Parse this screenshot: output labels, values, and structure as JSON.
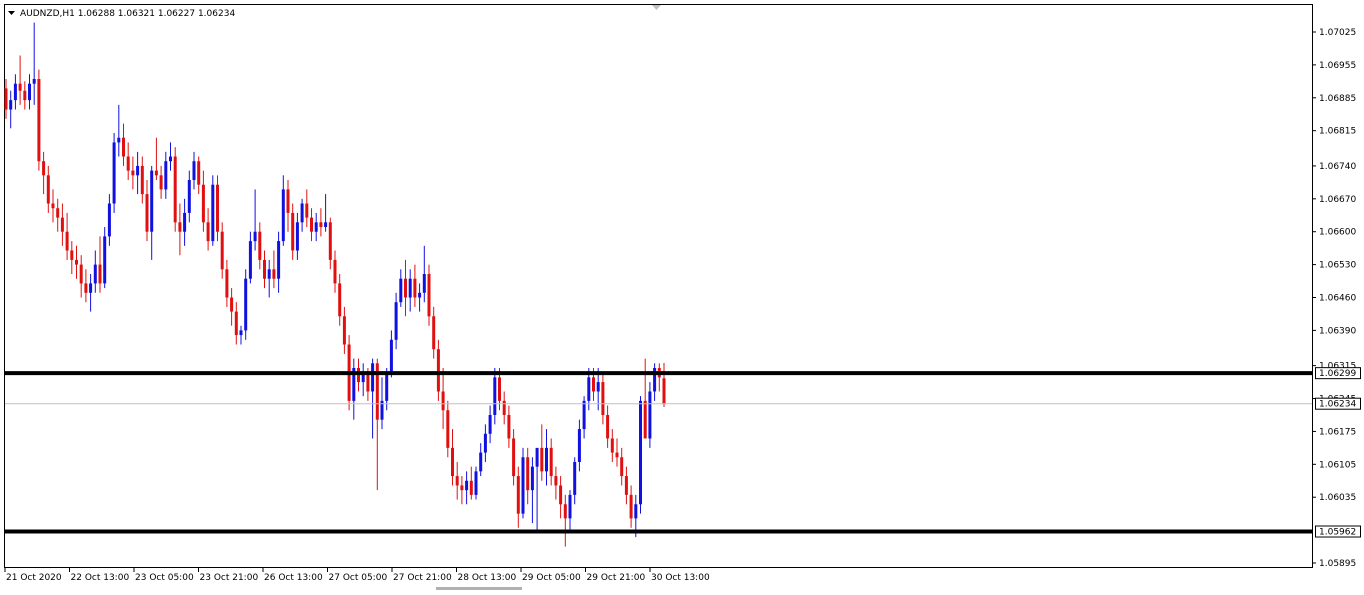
{
  "header": {
    "symbol_line": "AUDNZD,H1  1.06288 1.06321 1.06227 1.06234"
  },
  "colors": {
    "bull": "#1010e0",
    "bear": "#e01010",
    "level_line": "#000000",
    "current_line": "#c0c0c0",
    "price_tag_bg": "#000000",
    "current_tag_bg": "#000000",
    "background": "#ffffff"
  },
  "chart_data": {
    "type": "candlestick",
    "symbol": "AUDNZD",
    "timeframe": "H1",
    "header_values": {
      "open": 1.06288,
      "high": 1.06321,
      "low": 1.06227,
      "close": 1.06234
    },
    "y_ticks": [
      "1.07025",
      "1.06955",
      "1.06885",
      "1.06815",
      "1.06740",
      "1.06670",
      "1.06600",
      "1.06530",
      "1.06460",
      "1.06390",
      "1.06315",
      "1.06245",
      "1.06175",
      "1.06105",
      "1.06035",
      "1.05895"
    ],
    "x_labels": [
      "21 Oct 2020",
      "22 Oct 13:00",
      "23 Oct 05:00",
      "23 Oct 21:00",
      "26 Oct 13:00",
      "27 Oct 05:00",
      "27 Oct 21:00",
      "28 Oct 13:00",
      "29 Oct 05:00",
      "29 Oct 21:00",
      "30 Oct 13:00"
    ],
    "horizontal_levels": [
      {
        "price": 1.06299,
        "label": "1.06299"
      },
      {
        "price": 1.05962,
        "label": "1.05962"
      }
    ],
    "current_price": {
      "price": 1.06234,
      "label": "1.06234"
    },
    "candles": [
      [
        1.06905,
        1.06925,
        1.0684,
        1.0686
      ],
      [
        1.0686,
        1.069,
        1.0682,
        1.0688
      ],
      [
        1.0688,
        1.06935,
        1.0686,
        1.06915
      ],
      [
        1.06915,
        1.06975,
        1.0687,
        1.069
      ],
      [
        1.069,
        1.0692,
        1.0686,
        1.0688
      ],
      [
        1.0688,
        1.06935,
        1.0686,
        1.06915
      ],
      [
        1.06915,
        1.07045,
        1.0687,
        1.06925
      ],
      [
        1.06925,
        1.06945,
        1.0673,
        1.0675
      ],
      [
        1.0675,
        1.0677,
        1.0668,
        1.0672
      ],
      [
        1.0672,
        1.0674,
        1.0664,
        1.0666
      ],
      [
        1.0666,
        1.0669,
        1.0662,
        1.0665
      ],
      [
        1.0665,
        1.0667,
        1.066,
        1.0663
      ],
      [
        1.0663,
        1.0666,
        1.0657,
        1.066
      ],
      [
        1.066,
        1.0664,
        1.0654,
        1.0656
      ],
      [
        1.0656,
        1.0658,
        1.0651,
        1.0654
      ],
      [
        1.0654,
        1.0657,
        1.065,
        1.0653
      ],
      [
        1.0653,
        1.0655,
        1.0646,
        1.0649
      ],
      [
        1.0649,
        1.0652,
        1.0645,
        1.0647
      ],
      [
        1.0647,
        1.0651,
        1.0643,
        1.0649
      ],
      [
        1.0649,
        1.0656,
        1.0647,
        1.0653
      ],
      [
        1.0653,
        1.0659,
        1.0647,
        1.0649
      ],
      [
        1.0649,
        1.0661,
        1.0648,
        1.0659
      ],
      [
        1.0659,
        1.0668,
        1.0657,
        1.0666
      ],
      [
        1.0666,
        1.0681,
        1.0664,
        1.0679
      ],
      [
        1.0679,
        1.0687,
        1.0676,
        1.068
      ],
      [
        1.068,
        1.0683,
        1.0674,
        1.0676
      ],
      [
        1.0676,
        1.0679,
        1.0671,
        1.0673
      ],
      [
        1.0673,
        1.0676,
        1.0669,
        1.0672
      ],
      [
        1.0672,
        1.0677,
        1.0668,
        1.0674
      ],
      [
        1.0674,
        1.0676,
        1.0666,
        1.0668
      ],
      [
        1.0668,
        1.0671,
        1.0658,
        1.066
      ],
      [
        1.066,
        1.0674,
        1.0654,
        1.0673
      ],
      [
        1.0673,
        1.068,
        1.0671,
        1.0672
      ],
      [
        1.0672,
        1.0674,
        1.0667,
        1.0669
      ],
      [
        1.0669,
        1.0677,
        1.0667,
        1.0675
      ],
      [
        1.0675,
        1.0679,
        1.0673,
        1.0676
      ],
      [
        1.0676,
        1.0678,
        1.066,
        1.0662
      ],
      [
        1.0662,
        1.0666,
        1.0655,
        1.066
      ],
      [
        1.066,
        1.0667,
        1.0657,
        1.0664
      ],
      [
        1.0664,
        1.0673,
        1.0662,
        1.0671
      ],
      [
        1.0671,
        1.0677,
        1.0669,
        1.0675
      ],
      [
        1.0675,
        1.0676,
        1.0668,
        1.067
      ],
      [
        1.067,
        1.0673,
        1.066,
        1.0662
      ],
      [
        1.0662,
        1.0665,
        1.0656,
        1.0658
      ],
      [
        1.0658,
        1.0672,
        1.0657,
        1.067
      ],
      [
        1.067,
        1.0672,
        1.0658,
        1.066
      ],
      [
        1.066,
        1.0662,
        1.065,
        1.0652
      ],
      [
        1.0652,
        1.0654,
        1.0644,
        1.0646
      ],
      [
        1.0646,
        1.0648,
        1.064,
        1.0643
      ],
      [
        1.0643,
        1.0645,
        1.0636,
        1.0638
      ],
      [
        1.0638,
        1.064,
        1.0636,
        1.0639
      ],
      [
        1.0639,
        1.0652,
        1.0637,
        1.065
      ],
      [
        1.065,
        1.066,
        1.0649,
        1.0658
      ],
      [
        1.0658,
        1.0669,
        1.0656,
        1.066
      ],
      [
        1.066,
        1.0662,
        1.0652,
        1.0654
      ],
      [
        1.0654,
        1.0656,
        1.0648,
        1.065
      ],
      [
        1.065,
        1.0654,
        1.0646,
        1.0652
      ],
      [
        1.0652,
        1.0656,
        1.0648,
        1.065
      ],
      [
        1.065,
        1.066,
        1.0647,
        1.0658
      ],
      [
        1.0658,
        1.0672,
        1.0657,
        1.0669
      ],
      [
        1.0669,
        1.0671,
        1.066,
        1.0664
      ],
      [
        1.0664,
        1.0666,
        1.0654,
        1.0656
      ],
      [
        1.0656,
        1.0664,
        1.0654,
        1.0662
      ],
      [
        1.0662,
        1.0667,
        1.066,
        1.0666
      ],
      [
        1.0666,
        1.0669,
        1.0661,
        1.0663
      ],
      [
        1.0663,
        1.0665,
        1.0658,
        1.066
      ],
      [
        1.066,
        1.0664,
        1.0658,
        1.0662
      ],
      [
        1.0662,
        1.0665,
        1.0659,
        1.0661
      ],
      [
        1.0661,
        1.0668,
        1.066,
        1.0662
      ],
      [
        1.0662,
        1.0663,
        1.0652,
        1.0654
      ],
      [
        1.0654,
        1.0656,
        1.0647,
        1.0649
      ],
      [
        1.0649,
        1.0651,
        1.064,
        1.0642
      ],
      [
        1.0642,
        1.0644,
        1.0634,
        1.0636
      ],
      [
        1.0636,
        1.0638,
        1.0622,
        1.0624
      ],
      [
        1.0624,
        1.0633,
        1.062,
        1.0631
      ],
      [
        1.0631,
        1.0633,
        1.0626,
        1.0628
      ],
      [
        1.0628,
        1.0632,
        1.0625,
        1.063
      ],
      [
        1.063,
        1.0631,
        1.0624,
        1.0626
      ],
      [
        1.0626,
        1.0633,
        1.0616,
        1.0632
      ],
      [
        1.0632,
        1.0633,
        1.0605,
        1.062
      ],
      [
        1.062,
        1.0629,
        1.0618,
        1.0624
      ],
      [
        1.0624,
        1.0631,
        1.0622,
        1.063
      ],
      [
        1.063,
        1.0639,
        1.0629,
        1.0637
      ],
      [
        1.0637,
        1.0647,
        1.0635,
        1.0645
      ],
      [
        1.0645,
        1.0652,
        1.0644,
        1.065
      ],
      [
        1.065,
        1.0654,
        1.0642,
        1.0646
      ],
      [
        1.0646,
        1.0652,
        1.0643,
        1.065
      ],
      [
        1.065,
        1.0653,
        1.0644,
        1.0646
      ],
      [
        1.0646,
        1.0649,
        1.0643,
        1.0647
      ],
      [
        1.0647,
        1.0657,
        1.0645,
        1.0651
      ],
      [
        1.0651,
        1.0653,
        1.064,
        1.0642
      ],
      [
        1.0642,
        1.0644,
        1.0633,
        1.0635
      ],
      [
        1.0635,
        1.0637,
        1.0624,
        1.0626
      ],
      [
        1.0626,
        1.0631,
        1.0618,
        1.0622
      ],
      [
        1.0622,
        1.0624,
        1.0612,
        1.0614
      ],
      [
        1.0614,
        1.0618,
        1.0606,
        1.0608
      ],
      [
        1.0608,
        1.0611,
        1.0603,
        1.0606
      ],
      [
        1.0606,
        1.0608,
        1.0602,
        1.0605
      ],
      [
        1.0605,
        1.0609,
        1.0602,
        1.0607
      ],
      [
        1.0607,
        1.061,
        1.0603,
        1.0604
      ],
      [
        1.0604,
        1.061,
        1.0603,
        1.0609
      ],
      [
        1.0609,
        1.0615,
        1.0608,
        1.0613
      ],
      [
        1.0613,
        1.0619,
        1.0611,
        1.0617
      ],
      [
        1.0617,
        1.0623,
        1.0615,
        1.0621
      ],
      [
        1.0621,
        1.0631,
        1.0619,
        1.0629
      ],
      [
        1.0629,
        1.0631,
        1.0622,
        1.0624
      ],
      [
        1.0624,
        1.0626,
        1.0619,
        1.0621
      ],
      [
        1.0621,
        1.0623,
        1.0614,
        1.0616
      ],
      [
        1.0616,
        1.0618,
        1.0606,
        1.0608
      ],
      [
        1.0608,
        1.061,
        1.0597,
        1.06
      ],
      [
        1.06,
        1.0614,
        1.0599,
        1.0612
      ],
      [
        1.0612,
        1.0614,
        1.0602,
        1.0605
      ],
      [
        1.0605,
        1.0612,
        1.0598,
        1.061
      ],
      [
        1.061,
        1.0613,
        1.0596,
        1.0614
      ],
      [
        1.0614,
        1.0619,
        1.0607,
        1.0609
      ],
      [
        1.0609,
        1.0618,
        1.0606,
        1.0614
      ],
      [
        1.0614,
        1.0616,
        1.0606,
        1.0608
      ],
      [
        1.0608,
        1.061,
        1.0603,
        1.0606
      ],
      [
        1.0606,
        1.0608,
        1.0599,
        1.0602
      ],
      [
        1.0602,
        1.0604,
        1.0593,
        1.0599
      ],
      [
        1.0599,
        1.0605,
        1.0596,
        1.0604
      ],
      [
        1.0604,
        1.0612,
        1.0602,
        1.0611
      ],
      [
        1.0611,
        1.062,
        1.0609,
        1.0618
      ],
      [
        1.0618,
        1.0625,
        1.0616,
        1.0624
      ],
      [
        1.0624,
        1.0631,
        1.0622,
        1.0629
      ],
      [
        1.0629,
        1.0631,
        1.0624,
        1.0626
      ],
      [
        1.0626,
        1.0631,
        1.0622,
        1.0628
      ],
      [
        1.0628,
        1.063,
        1.0619,
        1.0621
      ],
      [
        1.0621,
        1.0623,
        1.0614,
        1.0616
      ],
      [
        1.0616,
        1.0618,
        1.0611,
        1.0613
      ],
      [
        1.0613,
        1.0616,
        1.061,
        1.0612
      ],
      [
        1.0612,
        1.0614,
        1.0606,
        1.0608
      ],
      [
        1.0608,
        1.061,
        1.0602,
        1.0604
      ],
      [
        1.0604,
        1.0606,
        1.0597,
        1.0599
      ],
      [
        1.0599,
        1.0604,
        1.0595,
        1.0602
      ],
      [
        1.0602,
        1.0625,
        1.06,
        1.0624
      ],
      [
        1.0624,
        1.0633,
        1.062,
        1.0616
      ],
      [
        1.0616,
        1.0628,
        1.0614,
        1.0626
      ],
      [
        1.0626,
        1.0632,
        1.0624,
        1.0631
      ],
      [
        1.0631,
        1.0632,
        1.0626,
        1.0629
      ],
      [
        1.06288,
        1.06321,
        1.06227,
        1.06234
      ]
    ]
  }
}
